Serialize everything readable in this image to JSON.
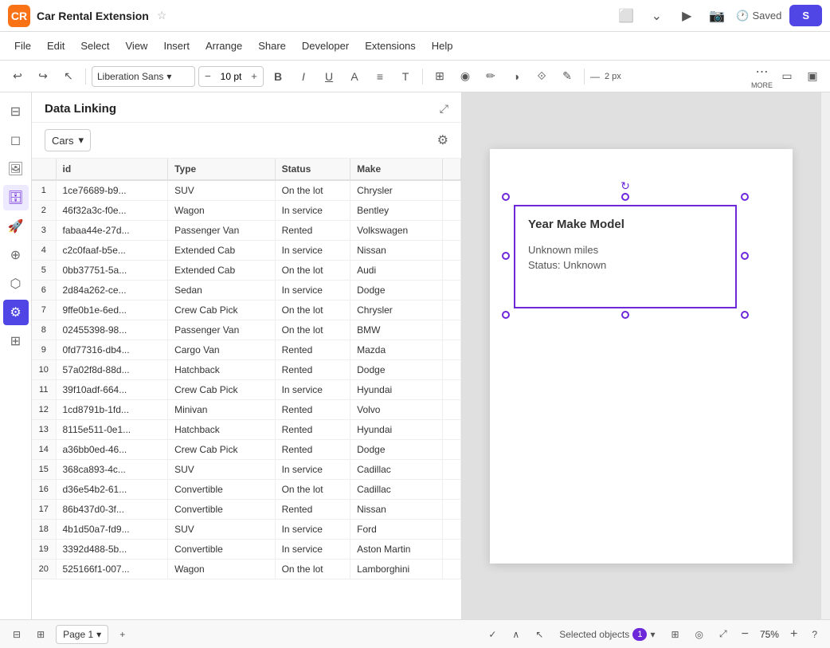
{
  "app": {
    "name": "Car Rental Extension",
    "logo": "CR"
  },
  "titlebar": {
    "saved_label": "Saved",
    "send_label": "S"
  },
  "menu": {
    "items": [
      "File",
      "Edit",
      "Select",
      "View",
      "Insert",
      "Arrange",
      "Share",
      "Developer",
      "Extensions",
      "Help"
    ]
  },
  "toolbar": {
    "font_name": "Liberation Sans",
    "font_size": "10 pt",
    "stroke_size": "2 px",
    "more_label": "MORE"
  },
  "data_panel": {
    "title": "Data Linking",
    "table_name": "Cars",
    "columns": [
      "id",
      "Type",
      "Status",
      "Make"
    ],
    "rows": [
      {
        "num": 1,
        "id": "1ce76689-b9...",
        "type": "SUV",
        "status": "On the lot",
        "make": "Chrysler"
      },
      {
        "num": 2,
        "id": "46f32a3c-f0e...",
        "type": "Wagon",
        "status": "In service",
        "make": "Bentley"
      },
      {
        "num": 3,
        "id": "fabaa44e-27d...",
        "type": "Passenger Van",
        "status": "Rented",
        "make": "Volkswagen"
      },
      {
        "num": 4,
        "id": "c2c0faaf-b5e...",
        "type": "Extended Cab",
        "status": "In service",
        "make": "Nissan"
      },
      {
        "num": 5,
        "id": "0bb37751-5a...",
        "type": "Extended Cab",
        "status": "On the lot",
        "make": "Audi"
      },
      {
        "num": 6,
        "id": "2d84a262-ce...",
        "type": "Sedan",
        "status": "In service",
        "make": "Dodge"
      },
      {
        "num": 7,
        "id": "9ffe0b1e-6ed...",
        "type": "Crew Cab Pick",
        "status": "On the lot",
        "make": "Chrysler"
      },
      {
        "num": 8,
        "id": "02455398-98...",
        "type": "Passenger Van",
        "status": "On the lot",
        "make": "BMW"
      },
      {
        "num": 9,
        "id": "0fd77316-db4...",
        "type": "Cargo Van",
        "status": "Rented",
        "make": "Mazda"
      },
      {
        "num": 10,
        "id": "57a02f8d-88d...",
        "type": "Hatchback",
        "status": "Rented",
        "make": "Dodge"
      },
      {
        "num": 11,
        "id": "39f10adf-664...",
        "type": "Crew Cab Pick",
        "status": "In service",
        "make": "Hyundai"
      },
      {
        "num": 12,
        "id": "1cd8791b-1fd...",
        "type": "Minivan",
        "status": "Rented",
        "make": "Volvo"
      },
      {
        "num": 13,
        "id": "8115e511-0e1...",
        "type": "Hatchback",
        "status": "Rented",
        "make": "Hyundai"
      },
      {
        "num": 14,
        "id": "a36bb0ed-46...",
        "type": "Crew Cab Pick",
        "status": "Rented",
        "make": "Dodge"
      },
      {
        "num": 15,
        "id": "368ca893-4c...",
        "type": "SUV",
        "status": "In service",
        "make": "Cadillac"
      },
      {
        "num": 16,
        "id": "d36e54b2-61...",
        "type": "Convertible",
        "status": "On the lot",
        "make": "Cadillac"
      },
      {
        "num": 17,
        "id": "86b437d0-3f...",
        "type": "Convertible",
        "status": "Rented",
        "make": "Nissan"
      },
      {
        "num": 18,
        "id": "4b1d50a7-fd9...",
        "type": "SUV",
        "status": "In service",
        "make": "Ford"
      },
      {
        "num": 19,
        "id": "3392d488-5b...",
        "type": "Convertible",
        "status": "In service",
        "make": "Aston Martin"
      },
      {
        "num": 20,
        "id": "525166f1-007...",
        "type": "Wagon",
        "status": "On the lot",
        "make": "Lamborghini"
      }
    ]
  },
  "canvas": {
    "card": {
      "title": "Year Make Model",
      "miles": "Unknown miles",
      "status": "Status: Unknown"
    }
  },
  "statusbar": {
    "page_label": "Page 1",
    "selected_label": "Selected objects",
    "selected_count": "1",
    "zoom_level": "75%",
    "help_icon": "?"
  }
}
